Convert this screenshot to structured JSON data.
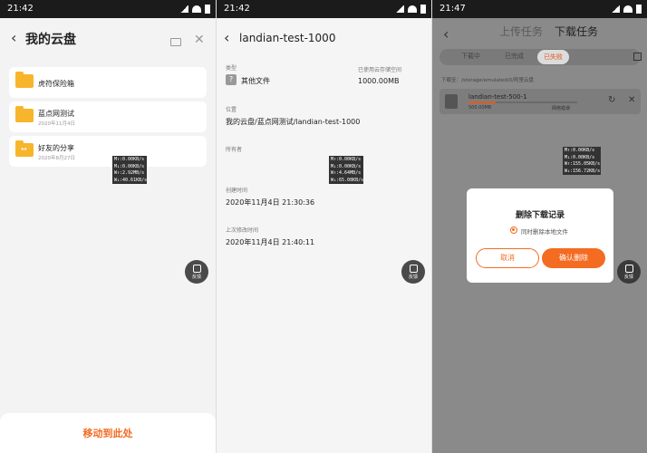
{
  "colors": {
    "accent": "#f46b22",
    "folder": "#f7b52c",
    "statusbar": "#1b1b1b"
  },
  "panel1": {
    "time": "21:42",
    "title": "我的云盘",
    "folders": [
      {
        "name": "虎符保险箱",
        "date": ""
      },
      {
        "name": "蓝点网测试",
        "date": "2020年11月4日"
      },
      {
        "name": "好友的分享",
        "date": "2020年8月27日"
      }
    ],
    "netstat": [
      "M↑:0.00KB/s",
      "M↓:0.00KB/s",
      "W↑:2.92MB/s",
      "W↓:40.61KB/s"
    ],
    "feedback": "反馈",
    "move_here": "移动到此处"
  },
  "panel2": {
    "time": "21:42",
    "title": "landian-test-1000",
    "type_label": "类型",
    "type_value": "其他文件",
    "used_label": "已使用云存储空间",
    "used_value": "1000.00MB",
    "location_label": "位置",
    "location_value": "我的云盘/蓝点网测试/landian-test-1000",
    "owner_label": "所有者",
    "created_label": "创建时间",
    "created_value": "2020年11月4日 21:30:36",
    "modified_label": "上次修改时间",
    "modified_value": "2020年11月4日 21:40:11",
    "netstat": [
      "M↑:0.00KB/s",
      "M↓:0.00KB/s",
      "W↑:4.64MB/s",
      "W↓:65.08KB/s"
    ],
    "feedback": "反馈"
  },
  "panel3": {
    "time": "21:47",
    "tab_upload": "上传任务",
    "tab_download": "下载任务",
    "filters": [
      "下载中",
      "已完成",
      "已失败"
    ],
    "path": "下载至：/storage/emulated/0/阿里云盘",
    "task": {
      "name": "landian-test-500-1",
      "size": "500.00MB",
      "status": "网络错误",
      "progress": 0.25
    },
    "netstat": [
      "M↑:0.00KB/s",
      "M↓:0.00KB/s",
      "W↑:155.05KB/s",
      "W↓:156.72KB/s"
    ],
    "feedback": "反馈",
    "dialog": {
      "title": "删除下载记录",
      "option": "同时删除本地文件",
      "cancel": "取消",
      "confirm": "确认删除"
    }
  }
}
